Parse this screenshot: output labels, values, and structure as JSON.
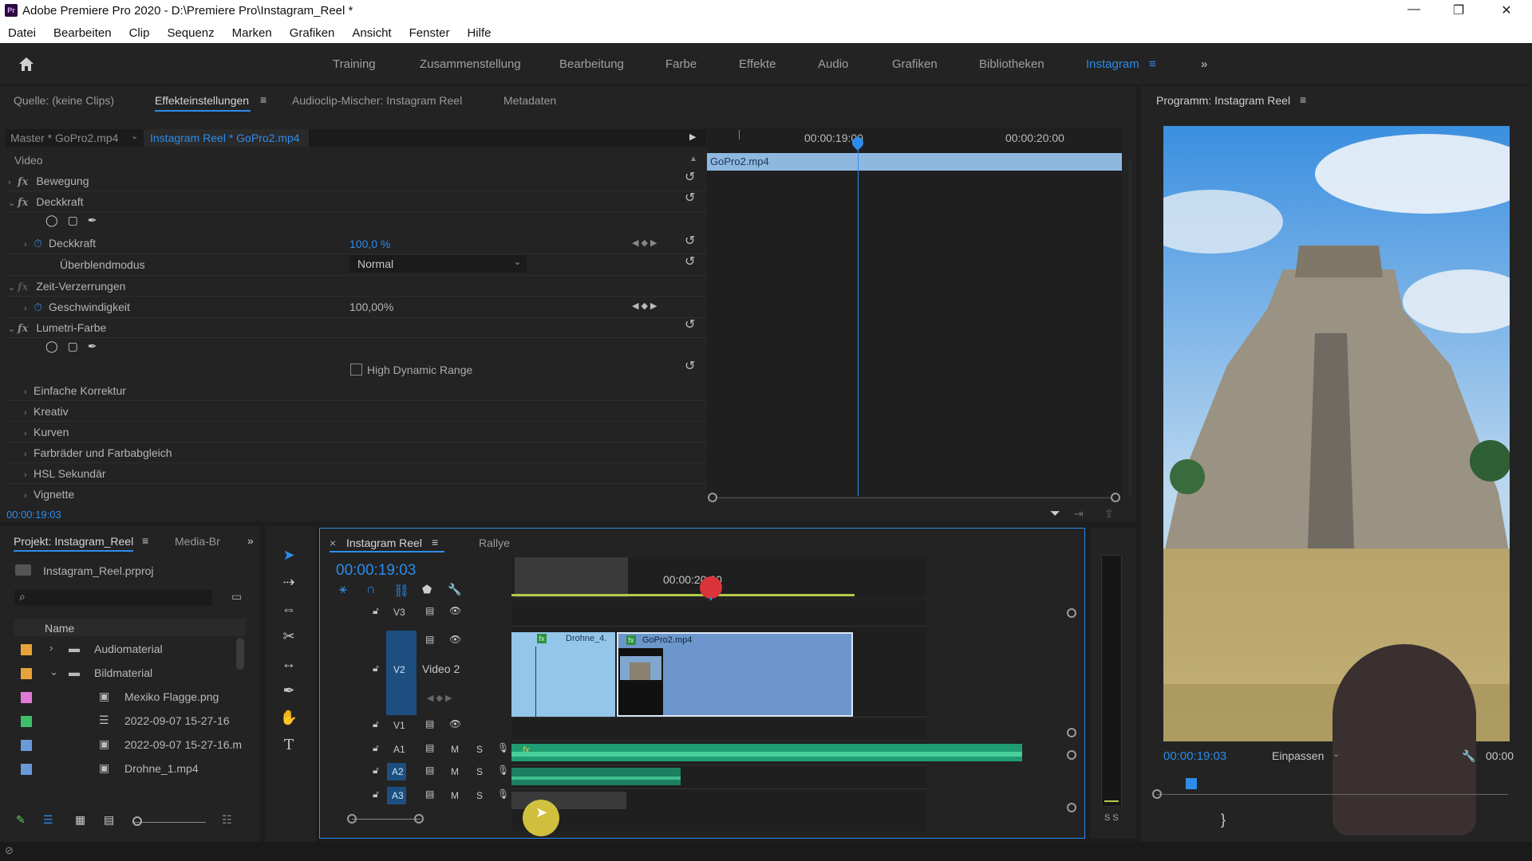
{
  "window": {
    "title": "Adobe Premiere Pro 2020 - D:\\Premiere Pro\\Instagram_Reel *",
    "logo_text": "Pr",
    "minimize": "—",
    "maximize": "❐",
    "close": "✕"
  },
  "menu": [
    "Datei",
    "Bearbeiten",
    "Clip",
    "Sequenz",
    "Marken",
    "Grafiken",
    "Ansicht",
    "Fenster",
    "Hilfe"
  ],
  "workspaces": {
    "items": [
      "Training",
      "Zusammenstellung",
      "Bearbeitung",
      "Farbe",
      "Effekte",
      "Audio",
      "Grafiken",
      "Bibliotheken",
      "Instagram"
    ],
    "active": "Instagram",
    "overflow": "»"
  },
  "effects_panel": {
    "tabs": [
      "Quelle: (keine Clips)",
      "Effekteinstellungen",
      "Audioclip-Mischer: Instagram Reel",
      "Metadaten"
    ],
    "master": "Master * GoPro2.mp4",
    "sequence_clip": "Instagram Reel * GoPro2.mp4",
    "section_video": "Video",
    "effects": {
      "bewegung": "Bewegung",
      "deckkraft": "Deckkraft",
      "deckkraft_param": "Deckkraft",
      "deckkraft_value": "100,0 %",
      "ueberblendmodus": "Überblendmodus",
      "blend_value": "Normal",
      "zeit": "Zeit-Verzerrungen",
      "geschwindigkeit": "Geschwindigkeit",
      "geschwindigkeit_value": "100,00%",
      "lumetri": "Lumetri-Farbe",
      "hdr": "High Dynamic Range",
      "subs": [
        "Einfache Korrektur",
        "Kreativ",
        "Kurven",
        "Farbräder und Farbabgleich",
        "HSL Sekundär",
        "Vignette"
      ]
    },
    "timecode": "00:00:19:03",
    "mini_timeline": {
      "tc1": "00:00:19:00",
      "tc2": "00:00:20:00",
      "clip": "GoPro2.mp4"
    }
  },
  "program_monitor": {
    "title": "Programm: Instagram Reel",
    "timecode": "00:00:19:03",
    "fit": "Einpassen",
    "tc_right": "00:00"
  },
  "project_panel": {
    "tabs": [
      "Projekt: Instagram_Reel",
      "Media-Br"
    ],
    "project_file": "Instagram_Reel.prproj",
    "search_placeholder": "",
    "column_name": "Name",
    "items": [
      {
        "name": "Audiomaterial",
        "color": "#e8a33a",
        "type": "folder"
      },
      {
        "name": "Bildmaterial",
        "color": "#e8a33a",
        "type": "folder"
      },
      {
        "name": "Mexiko Flagge.png",
        "color": "#e07ad6",
        "type": "image"
      },
      {
        "name": "2022-09-07 15-27-16",
        "color": "#3fbf6a",
        "type": "sequence"
      },
      {
        "name": "2022-09-07 15-27-16.m",
        "color": "#6a9ad8",
        "type": "file"
      },
      {
        "name": "Drohne_1.mp4",
        "color": "#6a9ad8",
        "type": "video"
      }
    ]
  },
  "timeline": {
    "tabs": [
      "Instagram Reel",
      "Rallye"
    ],
    "close": "×",
    "timecode": "00:00:19:03",
    "ruler_tc": "00:00:20:00",
    "tracks_video": [
      "V3",
      "V2",
      "V1"
    ],
    "track_v2_label": "Video 2",
    "tracks_audio": [
      "A1",
      "A2",
      "A3"
    ],
    "m": "M",
    "s": "S",
    "clip_drohne": "Drohne_4.",
    "clip_gopro": "GoPro2.mp4",
    "fx_badge": "fx",
    "meter_labels": "S S"
  }
}
